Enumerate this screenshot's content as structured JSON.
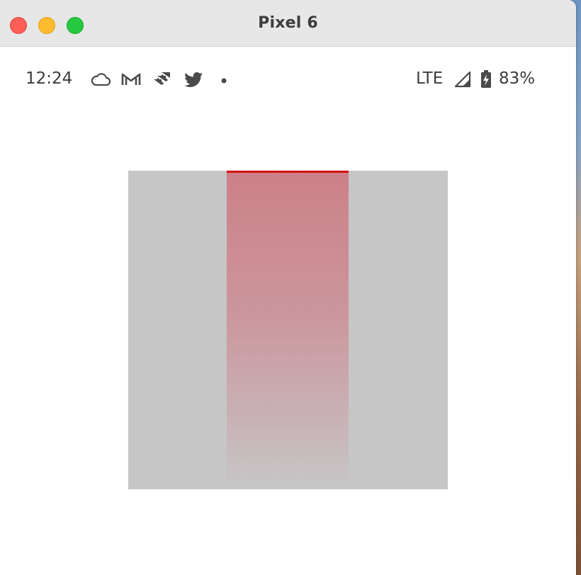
{
  "window": {
    "title": "Pixel 6"
  },
  "status_bar": {
    "time": "12:24",
    "notification_icons": [
      "cloud-icon",
      "gmail-icon",
      "jira-icon",
      "twitter-icon",
      "more-dot-icon"
    ],
    "network": "LTE",
    "signal_icon": "signal-icon",
    "battery_icon": "battery-charging-icon",
    "battery_level": "83%"
  },
  "colors": {
    "canvas": "#c6c6c6",
    "highlight_top": "#cd8088",
    "highlight_edge": "#d40d12",
    "status_text": "#3c3c3c"
  }
}
